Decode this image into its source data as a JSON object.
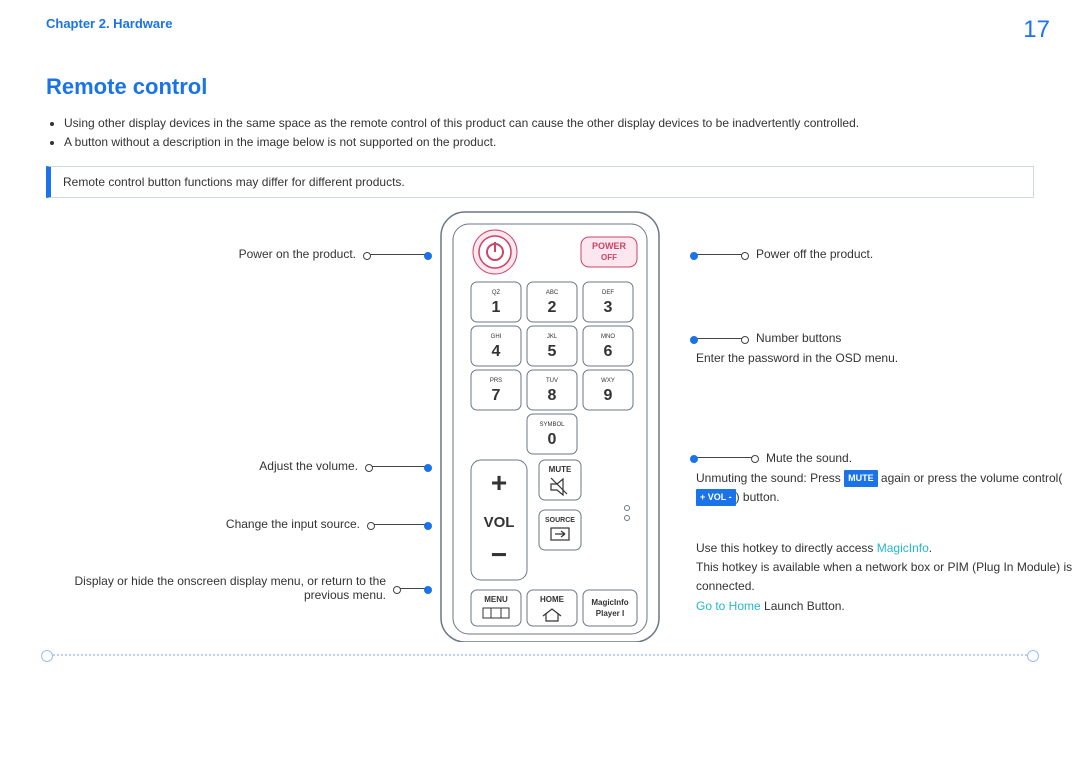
{
  "header": {
    "chapter": "Chapter 2. Hardware",
    "page_number": "17"
  },
  "title": "Remote control",
  "bullets": [
    "Using other display devices in the same space as the remote control of this product can cause the other display devices to be inadvertently controlled.",
    "A button without a description in the image below is not supported on the product."
  ],
  "note": "Remote control button functions may differ for different products.",
  "left_labels": {
    "power_on": "Power on the product.",
    "volume": "Adjust the volume.",
    "source": "Change the input source.",
    "menu": "Display or hide the onscreen display menu, or return to the previous menu."
  },
  "right_labels": {
    "power_off": "Power off the product.",
    "numbers_1": "Number buttons",
    "numbers_2": "Enter the password in the OSD menu.",
    "mute_1": "Mute the sound.",
    "mute_2a": "Unmuting the sound: Press ",
    "mute_tag": "MUTE",
    "mute_2b": " again or press the volume control(",
    "vol_tag": "+ VOL -",
    "mute_2c": ") button.",
    "magic_1a": "Use this hotkey to directly access ",
    "magic_link": "MagicInfo",
    "magic_1b": ".",
    "magic_2": "This hotkey is available when a network box or PIM (Plug In Module) is connected.",
    "home_link": "Go to Home",
    "home_b": " Launch Button."
  },
  "remote": {
    "power_off_label1": "POWER",
    "power_off_label2": "OFF",
    "keys": [
      {
        "t": "QZ",
        "n": "1"
      },
      {
        "t": "ABC",
        "n": "2"
      },
      {
        "t": "DEF",
        "n": "3"
      },
      {
        "t": "GHI",
        "n": "4"
      },
      {
        "t": "JKL",
        "n": "5"
      },
      {
        "t": "MNO",
        "n": "6"
      },
      {
        "t": "PRS",
        "n": "7"
      },
      {
        "t": "TUV",
        "n": "8"
      },
      {
        "t": "WXY",
        "n": "9"
      },
      {
        "t": "SYMBOL",
        "n": "0"
      }
    ],
    "vol": "VOL",
    "mute": "MUTE",
    "source": "SOURCE",
    "menu": "MENU",
    "home": "HOME",
    "magic1": "MagicInfo",
    "magic2": "Player I"
  }
}
